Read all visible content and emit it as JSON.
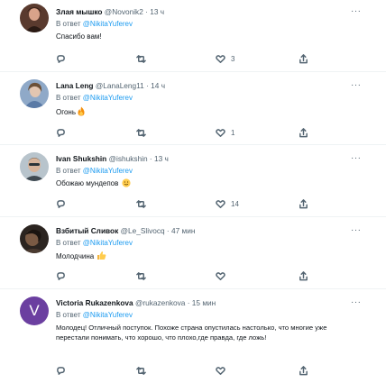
{
  "reply_prefix": "В ответ",
  "tweets": [
    {
      "name": "Злая мышко",
      "handle": "@Novonik2",
      "time": "13 ч",
      "reply_to": "@NikitaYuferev",
      "text": "Спасибо вам!",
      "emoji": "",
      "likes": "3",
      "avatar_icon": "photo-avatar"
    },
    {
      "name": "Lana Leng",
      "handle": "@LanaLeng11",
      "time": "14 ч",
      "reply_to": "@NikitaYuferev",
      "text": "Огонь",
      "emoji": "fire-emoji",
      "likes": "1",
      "avatar_icon": "photo-avatar"
    },
    {
      "name": "Ivan Shukshin",
      "handle": "@ishukshin",
      "time": "13 ч",
      "reply_to": "@NikitaYuferev",
      "text": "Обожаю мундепов",
      "emoji": "slightly-smiling-face-emoji",
      "likes": "14",
      "avatar_icon": "photo-avatar"
    },
    {
      "name": "Взбитый Сливок",
      "handle": "@Le_Slivocq",
      "time": "47 мин",
      "reply_to": "@NikitaYuferev",
      "text": "Молодчина",
      "emoji": "thumbs-up-emoji",
      "likes": "",
      "avatar_icon": "photo-avatar"
    },
    {
      "name": "Victoria Rukazenkova",
      "handle": "@rukazenkova",
      "time": "15 мин",
      "reply_to": "@NikitaYuferev",
      "text": "Молодец! Отличный поступок. Похоже страна опустилась настолько, что многие уже перестали понимать, что хорошо, что плохо,где правда, где ложь!",
      "emoji": "",
      "likes": "",
      "avatar_letter": "V"
    }
  ],
  "colors": {
    "accent": "#1d9bf0",
    "secondary_text": "#536471",
    "avatar_v_bg": "#6b3fa0"
  }
}
